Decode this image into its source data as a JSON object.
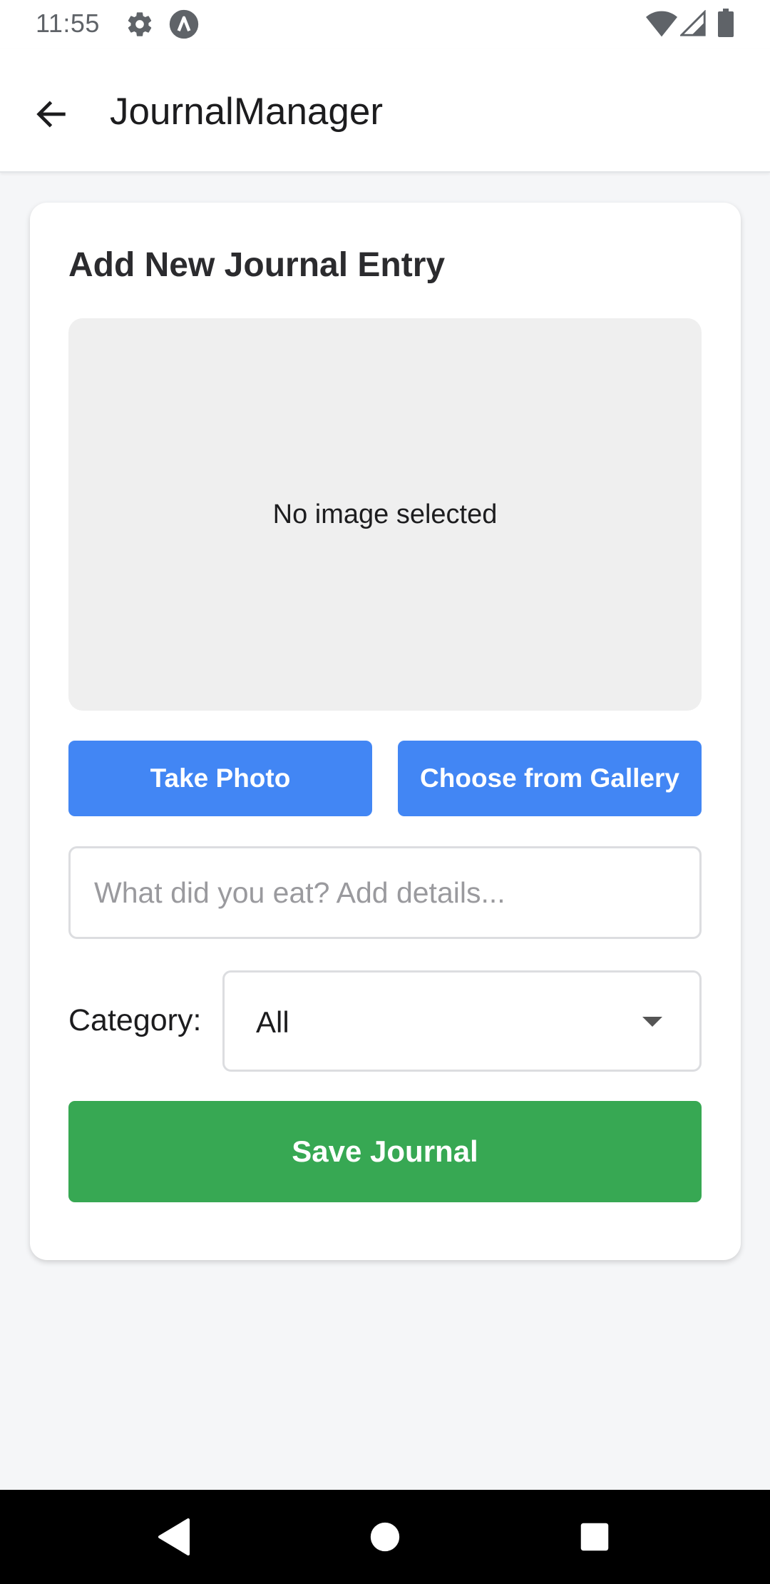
{
  "status_bar": {
    "time": "11:55",
    "icons": [
      "settings-icon",
      "app-a-icon",
      "wifi-icon",
      "signal-icon",
      "battery-icon"
    ]
  },
  "app_bar": {
    "title": "JournalManager",
    "back_icon": "arrow-left-icon"
  },
  "form": {
    "heading": "Add New Journal Entry",
    "image_placeholder": "No image selected",
    "take_photo_label": "Take Photo",
    "gallery_label": "Choose from Gallery",
    "details_placeholder": "What did you eat? Add details...",
    "details_value": "",
    "category_label": "Category:",
    "category_selected": "All",
    "save_label": "Save Journal"
  },
  "colors": {
    "primary_blue": "#4286f4",
    "save_green": "#37a853",
    "background": "#f5f6f8"
  },
  "nav_bar": {
    "buttons": [
      "back-triangle-icon",
      "home-circle-icon",
      "recents-square-icon"
    ]
  }
}
